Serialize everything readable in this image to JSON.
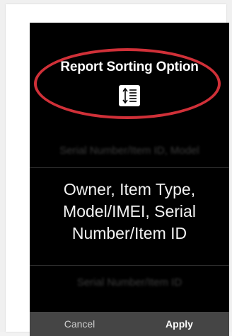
{
  "dialog": {
    "title": "Report Sorting Option",
    "icon": "sort-order-icon"
  },
  "picker": {
    "above_option": "Serial Number/Item ID, Model",
    "selected_option_lines": [
      "Owner, Item Type,",
      "Model/IMEI, Serial",
      "Number/Item ID"
    ],
    "below_option": "Serial Number/Item ID"
  },
  "footer": {
    "cancel_label": "Cancel",
    "apply_label": "Apply"
  },
  "colors": {
    "highlight": "#d03038",
    "dialog_background": "#000000",
    "footer_background": "#454545"
  }
}
